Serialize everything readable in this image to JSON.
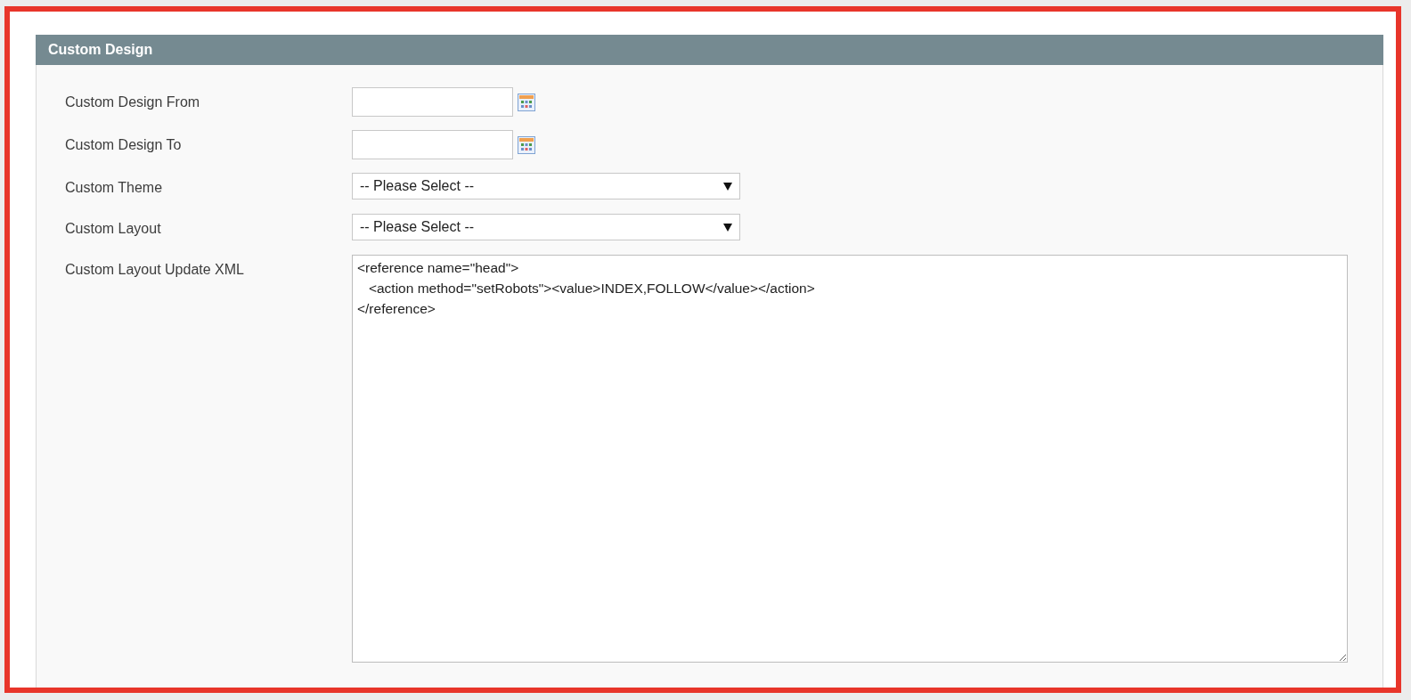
{
  "panel": {
    "title": "Custom Design"
  },
  "fields": [
    {
      "kind": "date",
      "label": "Custom Design From"
    },
    {
      "kind": "date",
      "label": "Custom Design To"
    },
    {
      "kind": "select",
      "label": "Custom Theme",
      "value": "-- Please Select --"
    },
    {
      "kind": "select",
      "label": "Custom Layout",
      "value": "-- Please Select --"
    },
    {
      "kind": "textarea",
      "label": "Custom Layout Update XML",
      "value": "<reference name=\"head\">\n   <action method=\"setRobots\"><value>INDEX,FOLLOW</value></action>\n</reference>"
    }
  ]
}
